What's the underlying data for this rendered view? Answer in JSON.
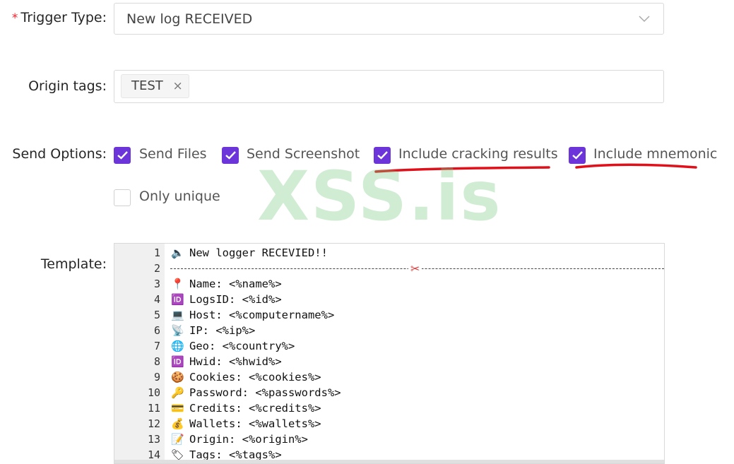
{
  "form": {
    "trigger_type": {
      "label": "Trigger Type",
      "colon": ":",
      "required_mark": "*",
      "value": "New log RECEIVED",
      "icon": "chevron-down-icon"
    },
    "origin_tags": {
      "label": "Origin tags",
      "colon": ":",
      "tags": [
        {
          "text": "TEST",
          "remove_glyph": "×"
        }
      ]
    },
    "send_options": {
      "label": "Send Options",
      "colon": ":",
      "options": [
        {
          "label": "Send Files",
          "checked": true
        },
        {
          "label": "Send Screenshot",
          "checked": true
        },
        {
          "label": "Include cracking results",
          "checked": true
        },
        {
          "label": "Include mnemonic",
          "checked": true
        },
        {
          "label": "Only unique",
          "checked": false
        }
      ]
    },
    "template": {
      "label": "Template",
      "colon": ":",
      "lines": [
        {
          "n": "1",
          "emoji": "🔈",
          "text": "New logger RECEVIED!!"
        },
        {
          "n": "2",
          "emoji": "",
          "text": ""
        },
        {
          "n": "3",
          "emoji": "📍",
          "text": "Name: <%name%>"
        },
        {
          "n": "4",
          "emoji": "🆔",
          "text": "LogsID: <%id%>"
        },
        {
          "n": "5",
          "emoji": "💻",
          "text": "Host: <%computername%>"
        },
        {
          "n": "6",
          "emoji": "📡",
          "text": "IP: <%ip%>"
        },
        {
          "n": "7",
          "emoji": "🌐",
          "text": "Geo: <%country%>"
        },
        {
          "n": "8",
          "emoji": "🆔",
          "text": "Hwid: <%hwid%>"
        },
        {
          "n": "9",
          "emoji": "🍪",
          "text": "Cookies: <%cookies%>"
        },
        {
          "n": "10",
          "emoji": "🔑",
          "text": "Password: <%passwords%>"
        },
        {
          "n": "11",
          "emoji": "💳",
          "text": "Credits: <%credits%>"
        },
        {
          "n": "12",
          "emoji": "💰",
          "text": "Wallets: <%wallets%>"
        },
        {
          "n": "13",
          "emoji": "📝",
          "text": "Origin: <%origin%>"
        },
        {
          "n": "14",
          "emoji": "🏷",
          "text": "Tags: <%tags%>"
        }
      ],
      "separator_glyph": "✂"
    }
  },
  "watermark": "XSS.is",
  "colors": {
    "checkbox_accent": "#6b35d9",
    "required_mark": "#f5222d",
    "annotation_underline": "#e0101a"
  }
}
